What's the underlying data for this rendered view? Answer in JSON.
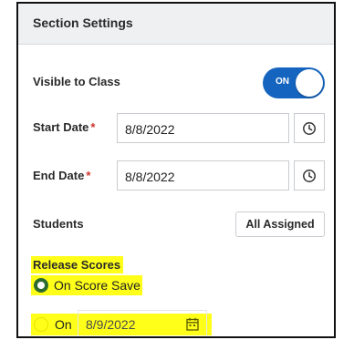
{
  "section": {
    "title": "Section Settings"
  },
  "visible_to_class": {
    "label": "Visible to Class",
    "toggle_label": "ON"
  },
  "start_date": {
    "label": "Start Date",
    "required_mark": "*",
    "value": "8/8/2022"
  },
  "end_date": {
    "label": "End Date",
    "required_mark": "*",
    "value": "8/8/2022"
  },
  "students": {
    "label": "Students",
    "button_label": "All Assigned"
  },
  "release_scores": {
    "label": "Release Scores",
    "options": [
      {
        "label": "On Score Save",
        "selected": true
      },
      {
        "label": "On",
        "selected": false,
        "date_value": "8/9/2022"
      }
    ]
  },
  "colors": {
    "accent": "#1565c0",
    "highlight": "#ffff1a",
    "required": "#d0342c",
    "radio_selected": "#2e6b2e"
  },
  "icons": [
    "clock-icon",
    "calendar-icon"
  ]
}
